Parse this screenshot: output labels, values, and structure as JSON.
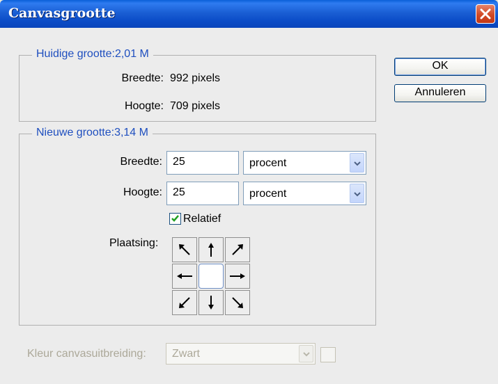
{
  "window": {
    "title": "Canvasgrootte"
  },
  "current_size": {
    "legend": "Huidige grootte:2,01 M",
    "width_label": "Breedte:",
    "width_value": "992 pixels",
    "height_label": "Hoogte:",
    "height_value": "709 pixels"
  },
  "new_size": {
    "legend": "Nieuwe grootte:3,14 M",
    "width_label": "Breedte:",
    "width_value": "25",
    "width_unit": "procent",
    "height_label": "Hoogte:",
    "height_value": "25",
    "height_unit": "procent",
    "relative_label": "Relatief",
    "relative_checked": true,
    "anchor_label": "Plaatsing:",
    "anchor_grid": [
      "arrow-up-left-icon",
      "arrow-up-icon",
      "arrow-up-right-icon",
      "arrow-left-icon",
      "anchor-center",
      "arrow-right-icon",
      "arrow-down-left-icon",
      "arrow-down-icon",
      "arrow-down-right-icon"
    ]
  },
  "extension": {
    "label": "Kleur canvasuitbreiding:",
    "value": "Zwart",
    "enabled": false
  },
  "buttons": {
    "ok": "OK",
    "cancel": "Annuleren"
  },
  "colors": {
    "title_bar": "#0b4cc7",
    "legend_text": "#1f4fbf",
    "close_button": "#d24a25",
    "checkmark": "#21a121"
  }
}
